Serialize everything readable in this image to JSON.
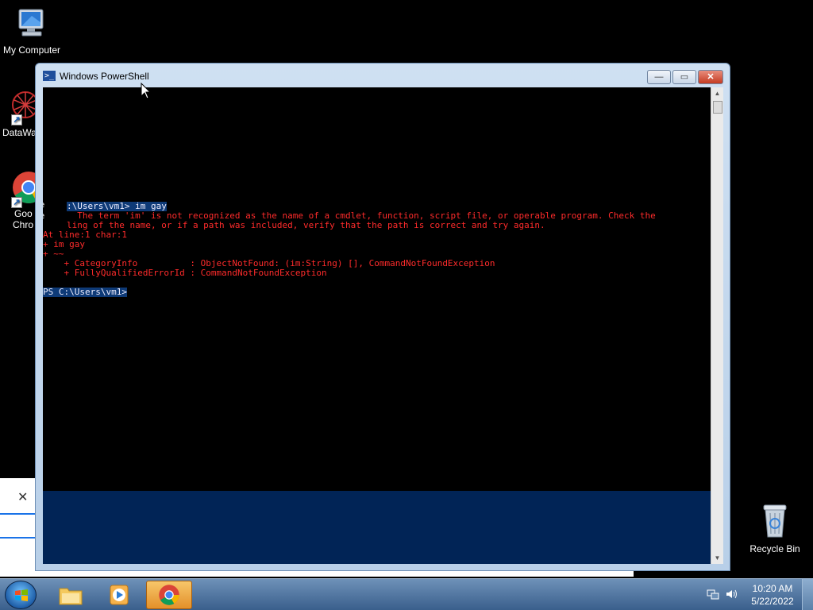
{
  "desktop": {
    "icons": [
      {
        "label": "My Computer",
        "icon": "computer-icon"
      },
      {
        "label": "DataWa",
        "icon": "datawa-icon"
      },
      {
        "label_line1": "Goo",
        "label_line2": "Chro",
        "icon": "chrome-icon"
      }
    ],
    "recycle_bin": {
      "label": "Recycle Bin",
      "icon": "recycle-bin-icon"
    }
  },
  "powershell": {
    "title": "Windows PowerShell",
    "buttons": {
      "minimize": "—",
      "maximize": "▭",
      "close": "✕"
    },
    "colors": {
      "console_bg": "#000000",
      "ps_blue": "#012456",
      "error": "#ff2b2b"
    },
    "lines": [
      {
        "text": ":\\Users\\vm1> im gay",
        "type": "sel"
      },
      {
        "text": "  The term 'im' is not recognized as the name of a cmdlet, function, script file, or operable program. Check the",
        "type": "err"
      },
      {
        "text": "ling of the name, or if a path was included, verify that the path is correct and try again.",
        "type": "err"
      },
      {
        "text": "At line:1 char:1",
        "type": "err"
      },
      {
        "text": "+ im gay",
        "type": "err"
      },
      {
        "text": "+ ~~",
        "type": "err"
      },
      {
        "text": "    + CategoryInfo          : ObjectNotFound: (im:String) [], CommandNotFoundException",
        "type": "err"
      },
      {
        "text": "    + FullyQualifiedErrorId : CommandNotFoundException",
        "type": "err"
      },
      {
        "text": "PS C:\\Users\\vm1>",
        "type": "sel"
      }
    ],
    "overlap_text": {
      "left1": "le",
      "left2": "ne"
    }
  },
  "taskbar": {
    "clock_time": "10:20 AM",
    "clock_date": "5/22/2022"
  }
}
